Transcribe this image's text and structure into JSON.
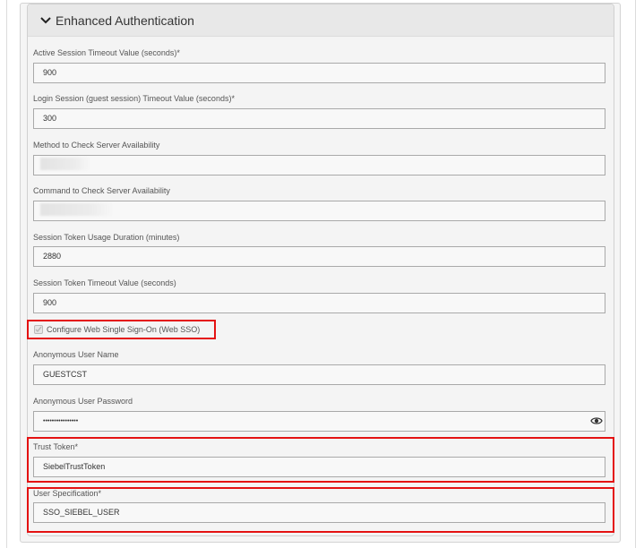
{
  "section": {
    "title": "Enhanced Authentication",
    "expanded": true
  },
  "fields": {
    "active_session_timeout": {
      "label": "Active Session Timeout Value (seconds)*",
      "value": "900"
    },
    "login_session_timeout": {
      "label": "Login Session (guest session) Timeout Value (seconds)*",
      "value": "300"
    },
    "method_check_server": {
      "label": "Method to Check Server Availability",
      "value": ""
    },
    "command_check_server": {
      "label": "Command to Check Server Availability",
      "value": ""
    },
    "session_token_usage": {
      "label": "Session Token Usage Duration (minutes)",
      "value": "2880"
    },
    "session_token_timeout": {
      "label": "Session Token Timeout Value (seconds)",
      "value": "900"
    },
    "anonymous_user_name": {
      "label": "Anonymous User Name",
      "value": "GUESTCST"
    },
    "anonymous_user_password": {
      "label": "Anonymous User Password",
      "value": "••••••••••••••••"
    },
    "trust_token": {
      "label": "Trust Token*",
      "value": "SiebelTrustToken"
    },
    "user_specification": {
      "label": "User Specification*",
      "value": "SSO_SIEBEL_USER"
    }
  },
  "web_sso": {
    "label": "Configure Web Single Sign-On (Web SSO)",
    "checked": true,
    "disabled": true
  },
  "colors": {
    "highlight": "#e41212",
    "panel_bg": "#f4f4f4",
    "header_bg": "#e8e8e8"
  }
}
